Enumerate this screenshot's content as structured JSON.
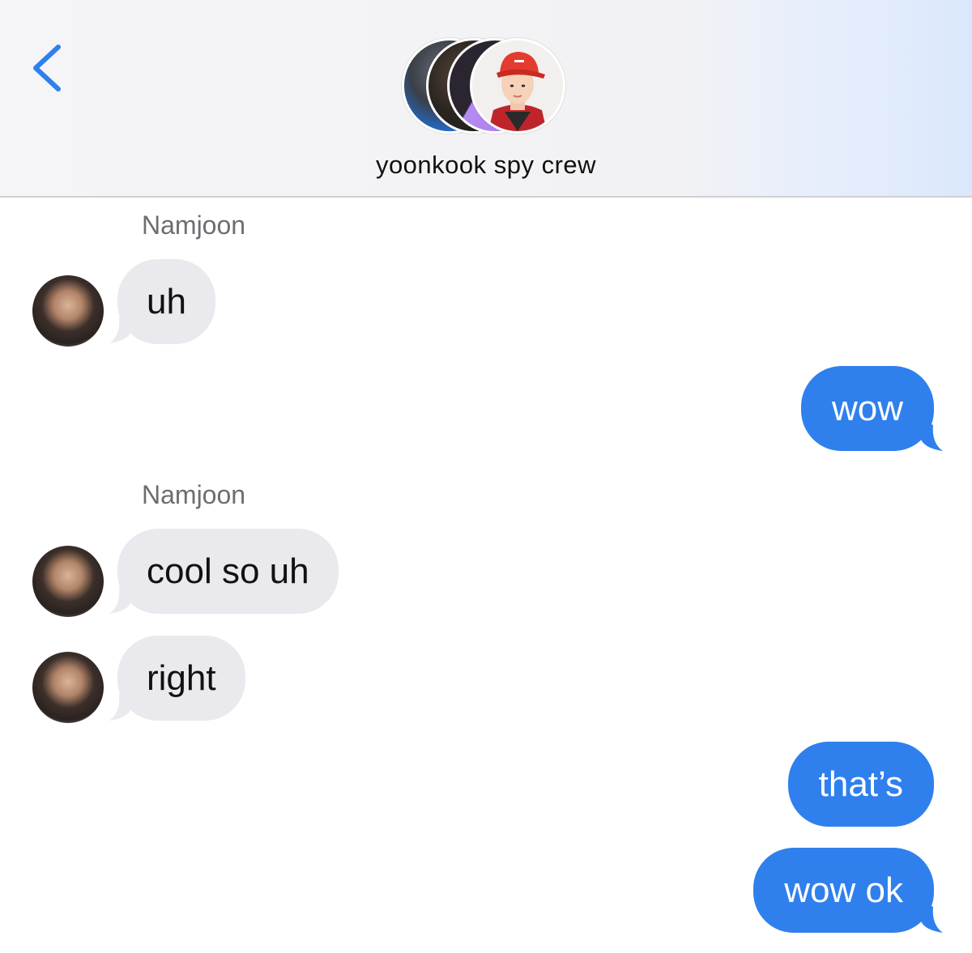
{
  "header": {
    "group_title": "yoonkook spy crew",
    "back_icon": "chevron-left-icon",
    "accent_color": "#2f80ed"
  },
  "messages": [
    {
      "direction": "incoming",
      "sender": "Namjoon",
      "text": "uh"
    },
    {
      "direction": "outgoing",
      "text": "wow"
    },
    {
      "direction": "incoming",
      "sender": "Namjoon",
      "text": "cool so uh"
    },
    {
      "direction": "incoming",
      "text": "right"
    },
    {
      "direction": "outgoing",
      "text": "that’s"
    },
    {
      "direction": "outgoing",
      "text": "wow ok"
    }
  ],
  "colors": {
    "incoming_bubble": "#e9e9ee",
    "outgoing_bubble": "#2f80ed"
  }
}
